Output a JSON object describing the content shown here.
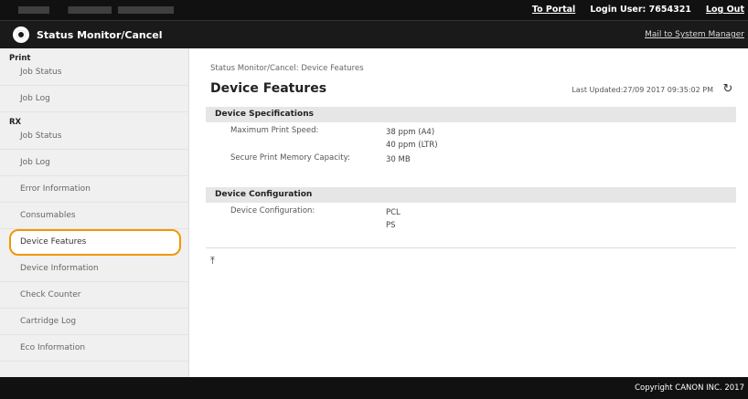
{
  "topbar": {
    "portal_link": "To Portal",
    "login_label": "Login User:",
    "login_user": "7654321",
    "logout": "Log Out"
  },
  "header": {
    "title": "Status Monitor/Cancel",
    "mail_link": "Mail to System Manager"
  },
  "sidebar": {
    "sections": [
      {
        "heading": "Print",
        "items": [
          "Job Status",
          "Job Log"
        ]
      },
      {
        "heading": "RX",
        "items": [
          "Job Status",
          "Job Log"
        ]
      }
    ],
    "other_items": [
      "Error Information",
      "Consumables",
      "Device Features",
      "Device Information",
      "Check Counter",
      "Cartridge Log",
      "Eco Information"
    ],
    "selected": "Device Features"
  },
  "main": {
    "breadcrumb": "Status Monitor/Cancel: Device Features",
    "title": "Device Features",
    "last_updated": "Last Updated:27/09 2017 09:35:02 PM",
    "specs": {
      "heading": "Device Specifications",
      "rows": [
        {
          "label": "Maximum Print Speed:",
          "lines": [
            "38 ppm (A4)",
            "40 ppm (LTR)"
          ]
        },
        {
          "label": "Secure Print Memory Capacity:",
          "lines": [
            "30 MB"
          ]
        }
      ]
    },
    "config": {
      "heading": "Device Configuration",
      "rows": [
        {
          "label": "Device Configuration:",
          "lines": [
            "PCL",
            "PS"
          ]
        }
      ]
    },
    "to_top_icon": "arrow-to-top-icon"
  },
  "footer": {
    "copyright": "Copyright CANON INC. 2017"
  },
  "colors": {
    "highlight": "#f29700",
    "topbar": "#111111",
    "sidebar_bg": "#f0f0f0",
    "section_bar": "#e6e6e6"
  }
}
